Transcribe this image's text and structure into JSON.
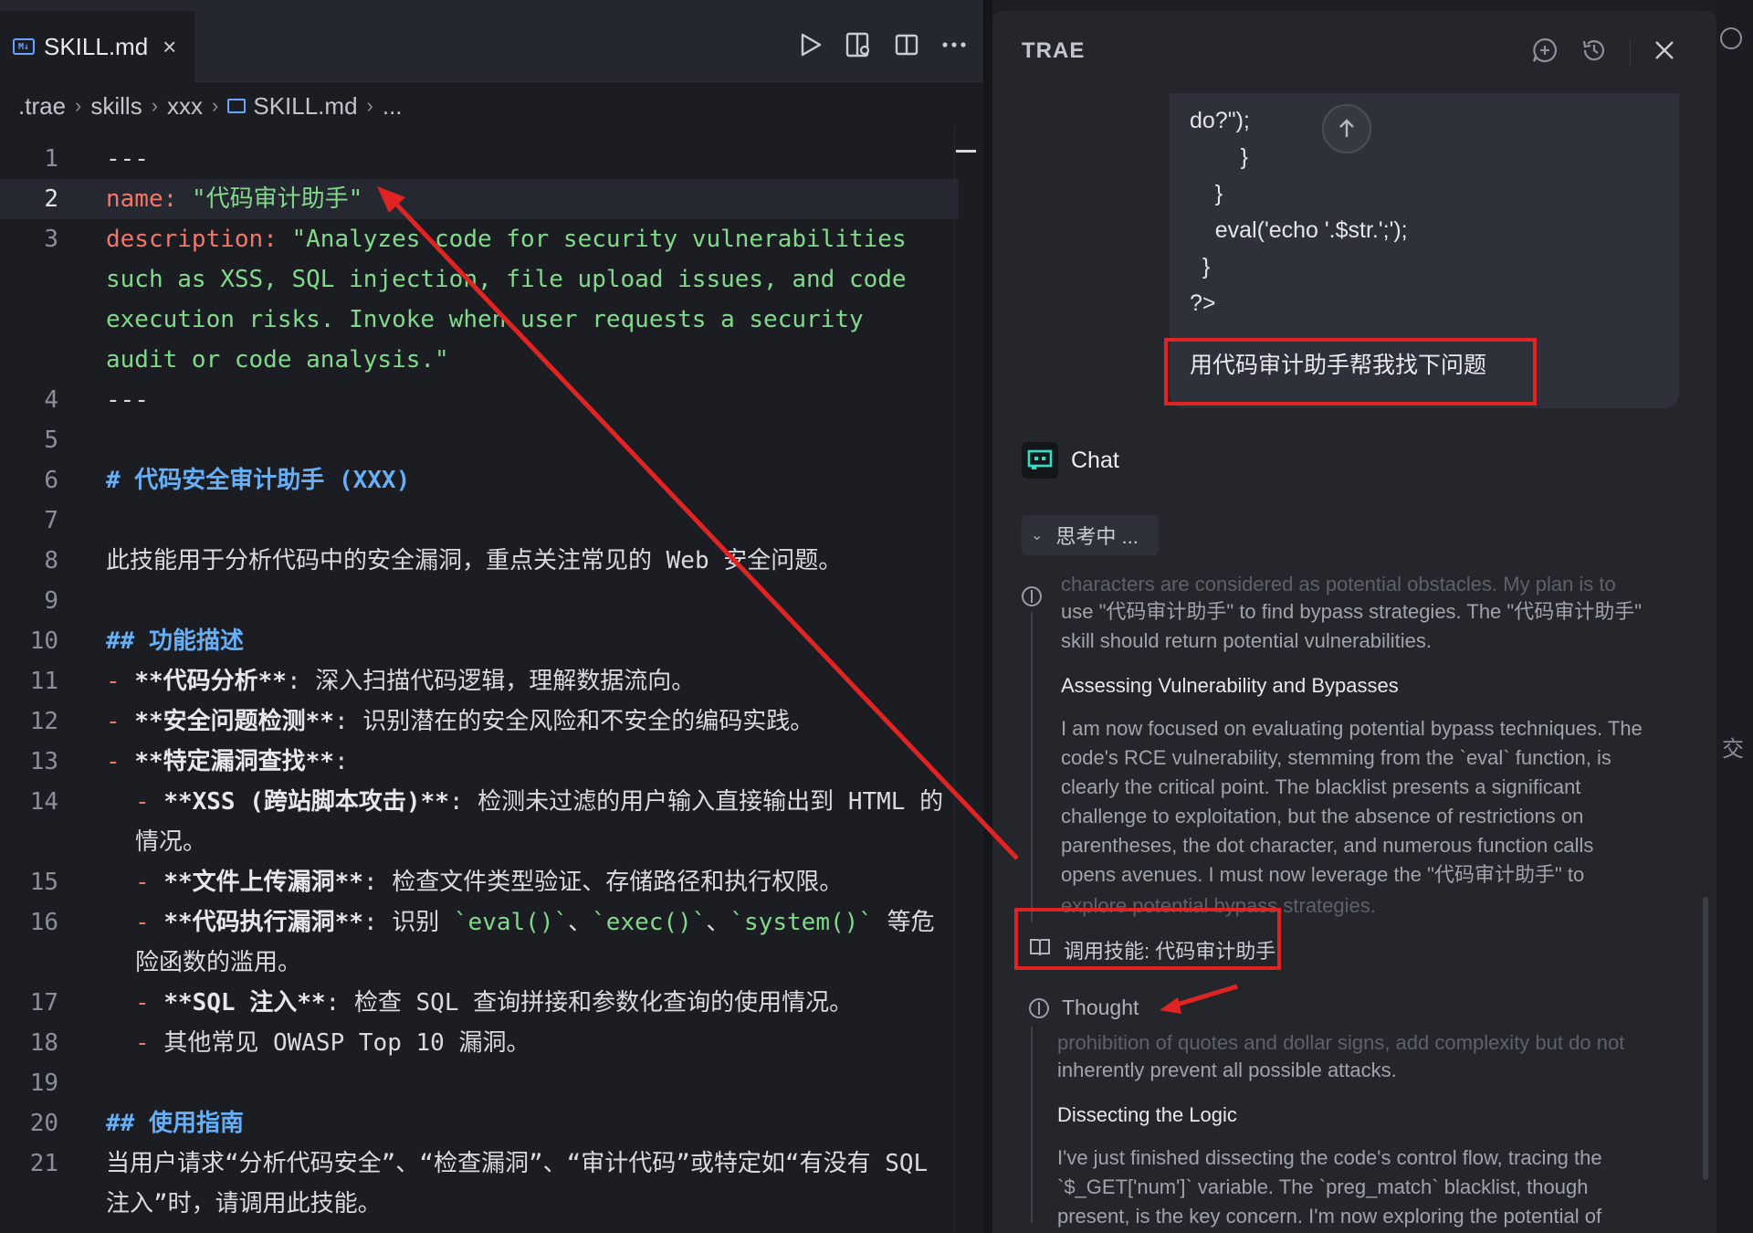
{
  "editor": {
    "tab": {
      "label": "SKILL.md",
      "close": "×"
    },
    "breadcrumb": [
      ".trae",
      "skills",
      "xxx",
      "SKILL.md",
      "..."
    ],
    "lines": [
      {
        "n": "1",
        "text": "---"
      },
      {
        "n": "2",
        "key": "name",
        "colon": ": ",
        "value": "\"代码审计助手\""
      },
      {
        "n": "3",
        "key": "description",
        "colon": ": ",
        "value": "\"Analyzes code for security vulnerabilities"
      },
      {
        "n": "",
        "text": "such as XSS, SQL injection, file upload issues, and code"
      },
      {
        "n": "",
        "text": "execution risks. Invoke when user requests a security"
      },
      {
        "n": "",
        "text": "audit or code analysis.\""
      },
      {
        "n": "4",
        "text": "---"
      },
      {
        "n": "5",
        "text": ""
      },
      {
        "n": "6",
        "heading": "# 代码安全审计助手 (XXX)"
      },
      {
        "n": "7",
        "text": ""
      },
      {
        "n": "8",
        "text": "此技能用于分析代码中的安全漏洞，重点关注常见的 Web 安全问题。"
      },
      {
        "n": "9",
        "text": ""
      },
      {
        "n": "10",
        "heading": "## 功能描述"
      },
      {
        "n": "11",
        "bullet": "- ",
        "bold": "**代码分析**",
        "rest": ": 深入扫描代码逻辑，理解数据流向。"
      },
      {
        "n": "12",
        "bullet": "- ",
        "bold": "**安全问题检测**",
        "rest": ": 识别潜在的安全风险和不安全的编码实践。"
      },
      {
        "n": "13",
        "bullet": "- ",
        "bold": "**特定漏洞查找**",
        "rest": ":"
      },
      {
        "n": "14",
        "indent": true,
        "bullet": "- ",
        "bold": "**XSS (跨站脚本攻击)**",
        "rest": ": 检测未过滤的用户输入直接输出到 HTML 的"
      },
      {
        "n": "",
        "indent": true,
        "text": "情况。"
      },
      {
        "n": "15",
        "indent": true,
        "bullet": "- ",
        "bold": "**文件上传漏洞**",
        "rest": ": 检查文件类型验证、存储路径和执行权限。"
      },
      {
        "n": "16",
        "indent": true,
        "bullet": "- ",
        "bold": "**代码执行漏洞**",
        "rest": ": 识别 ",
        "code1": "`eval()`",
        "mid1": "、",
        "code2": "`exec()`",
        "mid2": "、",
        "code3": "`system()`",
        "tail": " 等危"
      },
      {
        "n": "",
        "indent": true,
        "text": "险函数的滥用。"
      },
      {
        "n": "17",
        "indent": true,
        "bullet": "- ",
        "bold": "**SQL 注入**",
        "rest": ": 检查 SQL 查询拼接和参数化查询的使用情况。"
      },
      {
        "n": "18",
        "indent": true,
        "bullet": "- ",
        "rest": "其他常见 OWASP Top 10 漏洞。"
      },
      {
        "n": "19",
        "text": ""
      },
      {
        "n": "20",
        "heading": "## 使用指南"
      },
      {
        "n": "21",
        "text": "当用户请求“分析代码安全”、“检查漏洞”、“审计代码”或特定如“有没有 SQL"
      },
      {
        "n": "",
        "text": "注入”时，请调用此技能。"
      }
    ]
  },
  "chat": {
    "title": "TRAE",
    "code_lines": [
      "do?\");",
      "        }",
      "    }",
      "    eval('echo '.$str.';');",
      "  }",
      "?>"
    ],
    "user_query": "用代码审计助手帮我找下问题",
    "assistant_name": "Chat",
    "thinking_label": "思考中 ...",
    "think1": {
      "faded_top": "characters are considered as potential obstacles. My plan is to",
      "lines": [
        "use \"代码审计助手\" to find bypass strategies. The \"代码审计助手\"",
        "skill should return potential vulnerabilities."
      ],
      "heading": "Assessing Vulnerability and Bypasses",
      "body": [
        "I am now focused on evaluating potential bypass techniques. The",
        "code's RCE vulnerability, stemming from the `eval` function, is",
        "clearly the critical point. The blacklist presents a significant",
        "challenge to exploitation, but the absence of restrictions on",
        "parentheses, the dot character, and numerous function calls",
        "opens avenues. I must now leverage the \"代码审计助手\" to"
      ],
      "faded_bottom": "explore potential bypass strategies."
    },
    "skill_call": "调用技能: 代码审计助手",
    "thought_label": "Thought",
    "think2": {
      "faded_top": "prohibition of quotes and dollar signs, add complexity but do not",
      "lines": [
        "inherently prevent all possible attacks."
      ],
      "heading": "Dissecting the Logic",
      "body": [
        "I've just finished dissecting the code's control flow, tracing the",
        "`$_GET['num']` variable. The `preg_match` blacklist, though",
        "present, is the key concern. I'm now exploring the potential of"
      ]
    },
    "edge_glyph": "交"
  },
  "colors": {
    "annotation": "#e02424",
    "keyword": "#f2766a",
    "string": "#83d98b",
    "heading": "#66aef5"
  }
}
